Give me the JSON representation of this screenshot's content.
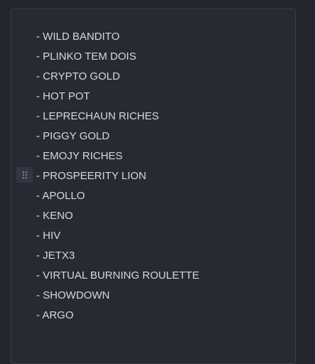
{
  "list": {
    "items": [
      "- WILD BANDITO",
      "- PLINKO TEM DOIS",
      "- CRYPTO GOLD",
      "- HOT POT",
      "- LEPRECHAUN RICHES",
      "- PIGGY GOLD",
      "- EMOJY RICHES",
      "- PROSPEERITY LION",
      "- APOLLO",
      "- KENO",
      "- HIV",
      "- JETX3",
      "- VIRTUAL BURNING ROULETTE",
      "- SHOWDOWN",
      "- ARGO"
    ]
  },
  "drag_handle": {
    "icon": "drag-handle-icon"
  },
  "colors": {
    "background": "#24262d",
    "panel": "#282a33",
    "text": "#d6d8de",
    "handle": "#343741"
  }
}
